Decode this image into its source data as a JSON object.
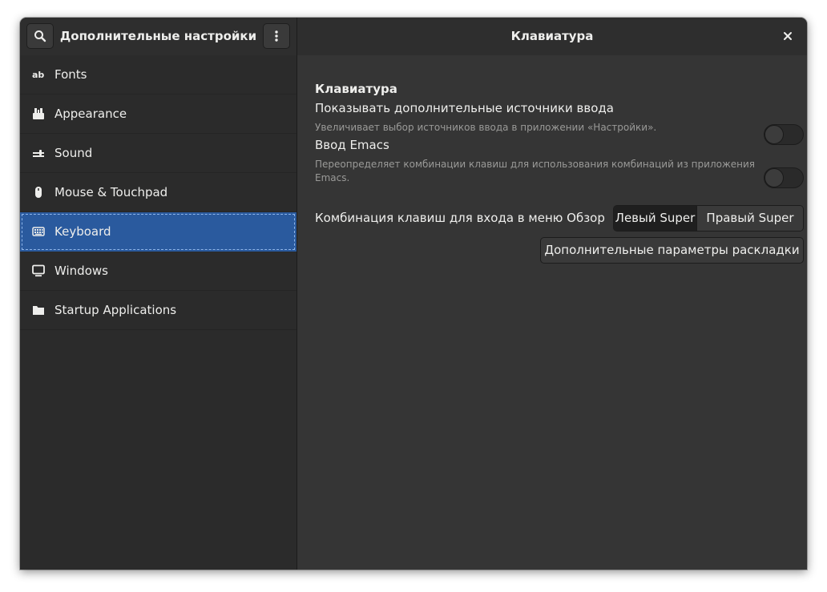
{
  "header": {
    "left_title": "Дополнительные настройки",
    "right_title": "Клавиатура",
    "search_icon": "search-icon",
    "menu_icon": "vertical-dots-icon",
    "close_icon": "close-icon"
  },
  "sidebar": {
    "items": [
      {
        "label": "Fonts",
        "icon": "fonts-icon"
      },
      {
        "label": "Appearance",
        "icon": "appearance-icon"
      },
      {
        "label": "Sound",
        "icon": "sound-icon"
      },
      {
        "label": "Mouse & Touchpad",
        "icon": "mouse-icon"
      },
      {
        "label": "Keyboard",
        "icon": "keyboard-icon",
        "active": true
      },
      {
        "label": "Windows",
        "icon": "monitor-icon"
      },
      {
        "label": "Startup Applications",
        "icon": "folder-icon"
      }
    ]
  },
  "keyboard": {
    "section_title": "Клавиатура",
    "extra_sources": {
      "label": "Показывать дополнительные источники ввода",
      "description": "Увеличивает выбор источников ввода в приложении «Настройки».",
      "enabled": false
    },
    "emacs": {
      "label": "Ввод Emacs",
      "description_line1": "Переопределяет комбинации клавиш для использования комбинаций из приложения",
      "description_line2": "Emacs.",
      "enabled": false
    },
    "overview_key": {
      "label": "Комбинация клавиш для входа в меню Обзор",
      "options": [
        "Левый Super",
        "Правый Super"
      ],
      "selected": "Левый Super"
    },
    "advanced_button": "Дополнительные параметры раскладки"
  },
  "colors": {
    "accent": "#2a5a9e",
    "background": "#353535",
    "sidebar": "#2b2b2b"
  }
}
